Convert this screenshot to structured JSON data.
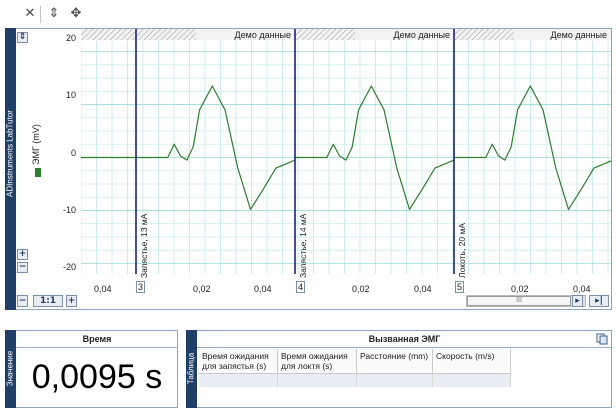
{
  "toolbar": {
    "icons": [
      "close-icon",
      "marker-icon",
      "autoscale-icon"
    ]
  },
  "chart": {
    "side_label": "ADInstruments  LabTutor",
    "channel_label": "ЭМГ (mV)",
    "channel_color": "#2e7d2e",
    "y_ticks": [
      "20",
      "10",
      "0",
      "-10",
      "-20"
    ],
    "blocks": [
      {
        "header": "",
        "number": "3",
        "comment": "Запястье, 13 мА",
        "ticks": [
          "0,04",
          "0,02"
        ]
      },
      {
        "header": "Демо данные",
        "number": "4",
        "comment": "Запястье, 14 мА",
        "ticks": [
          "0,02",
          "0,04"
        ]
      },
      {
        "header": "Демо данные",
        "number": "5",
        "comment": "Локоть, 20 мА",
        "ticks": [
          "0,02",
          "0,04"
        ]
      }
    ],
    "first_tick": "0,04",
    "zoom_label": "1:1",
    "scroll_grip": "III"
  },
  "chart_data": {
    "type": "line",
    "title": "",
    "xlabel": "",
    "ylabel": "ЭМГ (mV)",
    "ylim": [
      -22,
      22
    ],
    "grid": true,
    "series": [
      {
        "x": [
          0,
          0.005,
          0.01,
          0.012,
          0.014,
          0.016,
          0.018,
          0.02,
          0.024,
          0.028,
          0.032,
          0.036,
          0.04,
          0.044,
          0.048,
          0.05
        ],
        "values": [
          0,
          0,
          0,
          2.5,
          0.3,
          -0.5,
          2,
          9,
          13.5,
          9,
          -2,
          -9.8,
          -6,
          -2,
          -1,
          -0.5
        ]
      }
    ]
  },
  "value_panel": {
    "side_label": "Значение",
    "title": "Время",
    "value": "0,0095 s"
  },
  "table_panel": {
    "side_label": "Таблица",
    "title": "Вызванная ЭМГ",
    "columns": [
      "Время ожидания для запястья (s)",
      "Время ожидания для локтя (s)",
      "Расстояние (mm)",
      "Скорость (m/s)"
    ]
  }
}
